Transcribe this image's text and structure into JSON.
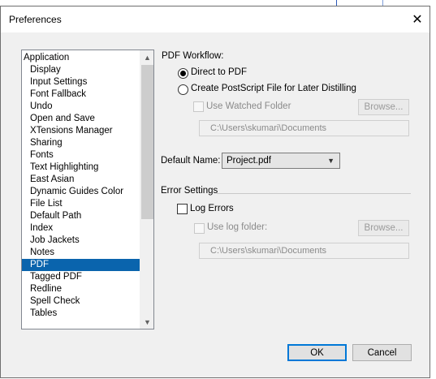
{
  "dialog": {
    "title": "Preferences",
    "close_glyph": "✕"
  },
  "sidebar": {
    "items": [
      "Application",
      "Display",
      "Input Settings",
      "Font Fallback",
      "Undo",
      "Open and Save",
      "XTensions Manager",
      "Sharing",
      "Fonts",
      "Text Highlighting",
      "East Asian",
      "Dynamic Guides Color",
      "File List",
      "Default Path",
      "Index",
      "Job Jackets",
      "Notes",
      "PDF",
      "Tagged PDF",
      "Redline",
      "Spell Check",
      "Tables"
    ],
    "selected": "PDF"
  },
  "pdf_workflow": {
    "heading": "PDF Workflow:",
    "direct_label": "Direct to PDF",
    "postscript_label": "Create PostScript File for Later Distilling",
    "watched_folder_label": "Use Watched Folder",
    "browse_label": "Browse...",
    "watched_folder_path": "C:\\Users\\skumari\\Documents"
  },
  "default_name": {
    "label": "Default Name:",
    "value": "Project.pdf"
  },
  "error_settings": {
    "heading": "Error Settings",
    "log_errors_label": "Log Errors",
    "use_log_folder_label": "Use log folder:",
    "browse_label": "Browse...",
    "log_folder_path": "C:\\Users\\skumari\\Documents"
  },
  "footer": {
    "ok_label": "OK",
    "cancel_label": "Cancel"
  },
  "icons": {
    "scroll_up": "▲",
    "scroll_down": "▼",
    "dropdown": "▼"
  },
  "colors": {
    "selection": "#0a64ad",
    "default_button_border": "#0078d7"
  }
}
